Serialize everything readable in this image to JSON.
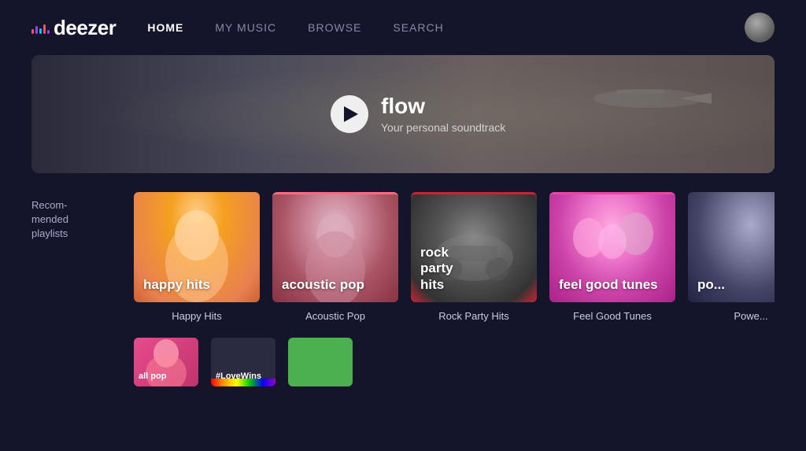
{
  "nav": {
    "logo_text": "deezer",
    "links": [
      {
        "label": "HOME",
        "active": true
      },
      {
        "label": "MY MUSIC",
        "active": false
      },
      {
        "label": "BROWSE",
        "active": false
      },
      {
        "label": "SEARCH",
        "active": false
      }
    ]
  },
  "hero": {
    "title": "flow",
    "subtitle": "Your personal soundtrack",
    "play_label": "Play"
  },
  "recommended": {
    "section_label": "Recom-\nmended\nplaylists",
    "playlists": [
      {
        "id": "happy",
        "cover_text": "happy hits",
        "name": "Happy Hits"
      },
      {
        "id": "acoustic",
        "cover_text": "acoustic pop",
        "name": "Acoustic Pop"
      },
      {
        "id": "rock",
        "cover_text": "rock\nparty\nhits",
        "name": "Rock Party Hits"
      },
      {
        "id": "feelgood",
        "cover_text": "feel good tunes",
        "name": "Feel Good Tunes"
      },
      {
        "id": "power",
        "cover_text": "po...",
        "name": "Power..."
      }
    ]
  },
  "section2": {
    "mini_playlists": [
      {
        "id": "allpop",
        "cover_text": "all pop",
        "bg": "#e74c8b"
      },
      {
        "id": "lovewins",
        "cover_text": "#LoveWins",
        "bg": "#4a4a60"
      },
      {
        "id": "green",
        "cover_text": "",
        "bg": "#4caf50"
      }
    ]
  }
}
